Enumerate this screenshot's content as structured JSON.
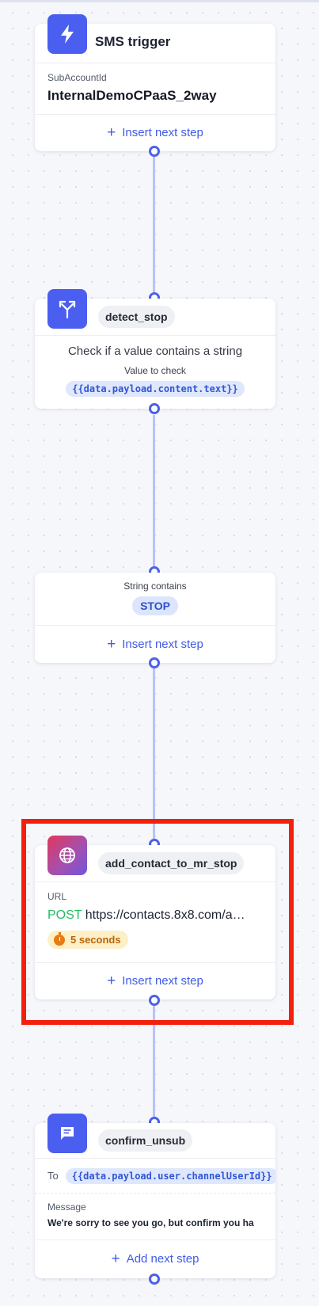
{
  "sms_trigger": {
    "title": "SMS trigger",
    "subaccount_label": "SubAccountId",
    "subaccount_value": "InternalDemoCPaaS_2way",
    "insert_label": "Insert next step"
  },
  "detect_stop": {
    "name": "detect_stop",
    "description": "Check if a value contains a string",
    "value_label": "Value to check",
    "value": "{{data.payload.content.text}}"
  },
  "string_contains": {
    "label": "String contains",
    "value": "STOP",
    "insert_label": "Insert next step"
  },
  "add_contact": {
    "name": "add_contact_to_mr_stop",
    "url_label": "URL",
    "method": "POST",
    "url": "https://contacts.8x8.com/a…",
    "delay": "5 seconds",
    "insert_label": "Insert next step"
  },
  "confirm_unsub": {
    "name": "confirm_unsub",
    "to_label": "To",
    "to_value": "{{data.payload.user.channelUserId}}",
    "message_label": "Message",
    "message_value": "We're sorry to see you go, but confirm you ha",
    "add_label": "Add next step"
  },
  "colors": {
    "accent": "#4c61ea",
    "connector": "#b9c2f6",
    "highlight": "#f2200c",
    "post": "#1fbf5f"
  },
  "icons": {
    "sms_trigger": "lightning-bolt-icon",
    "detect_stop": "branch-split-icon",
    "add_contact": "globe-icon",
    "confirm_unsub": "chat-bubble-icon",
    "delay": "stopwatch-icon"
  }
}
